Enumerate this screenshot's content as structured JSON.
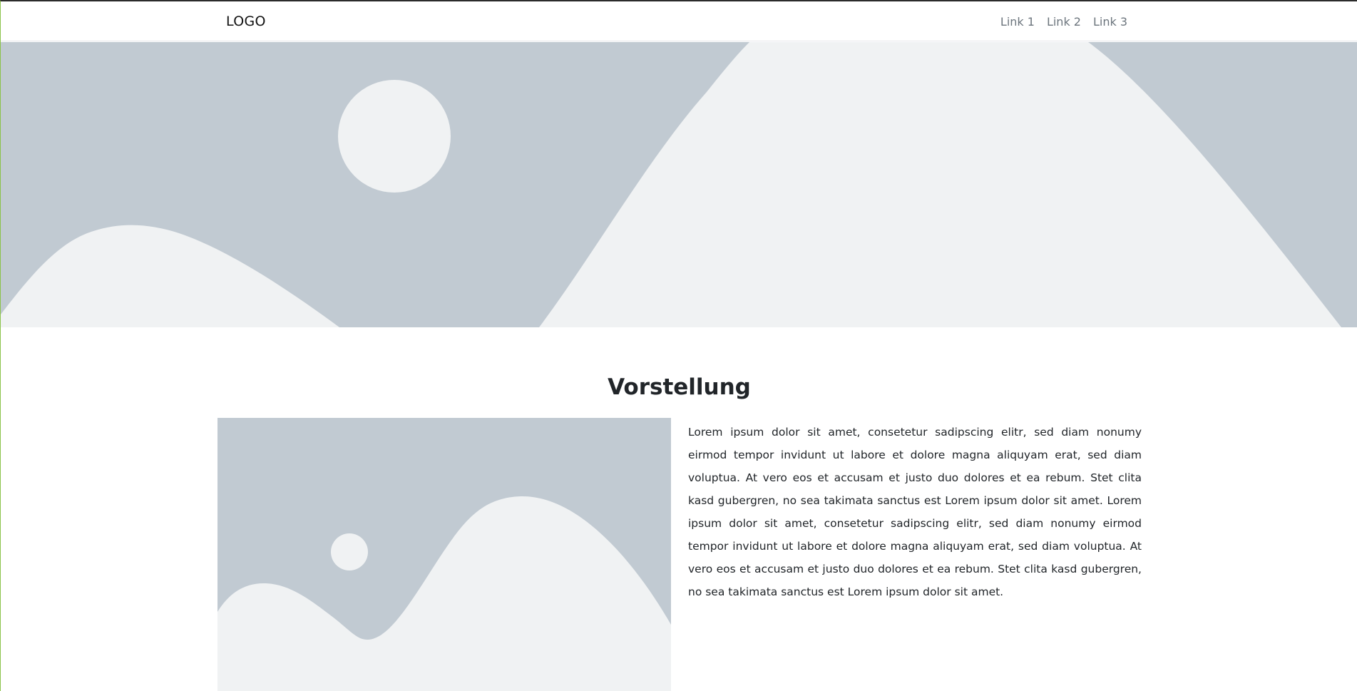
{
  "navbar": {
    "logo": "LOGO",
    "links": [
      {
        "label": "Link 1"
      },
      {
        "label": "Link 2"
      },
      {
        "label": "Link 3"
      }
    ]
  },
  "hero": {
    "image": "placeholder-landscape-image",
    "colors": {
      "background": "#c1cad2",
      "foreground": "#f0f2f3"
    }
  },
  "intro": {
    "title": "Vorstellung",
    "image": "placeholder-landscape-image",
    "text": "Lorem ipsum dolor sit amet, consetetur sadipscing elitr, sed diam nonumy eirmod tempor invidunt ut labore et dolore magna aliquyam erat, sed diam voluptua. At vero eos et accusam et justo duo dolores et ea rebum. Stet clita kasd gubergren, no sea takimata sanctus est Lorem ipsum dolor sit amet. Lorem ipsum dolor sit amet, consetetur sadipscing elitr, sed diam nonumy eirmod tempor invidunt ut labore et dolore magna aliquyam erat, sed diam voluptua. At vero eos et accusam et justo duo dolores et ea rebum. Stet clita kasd gubergren, no sea takimata sanctus est Lorem ipsum dolor sit amet."
  }
}
